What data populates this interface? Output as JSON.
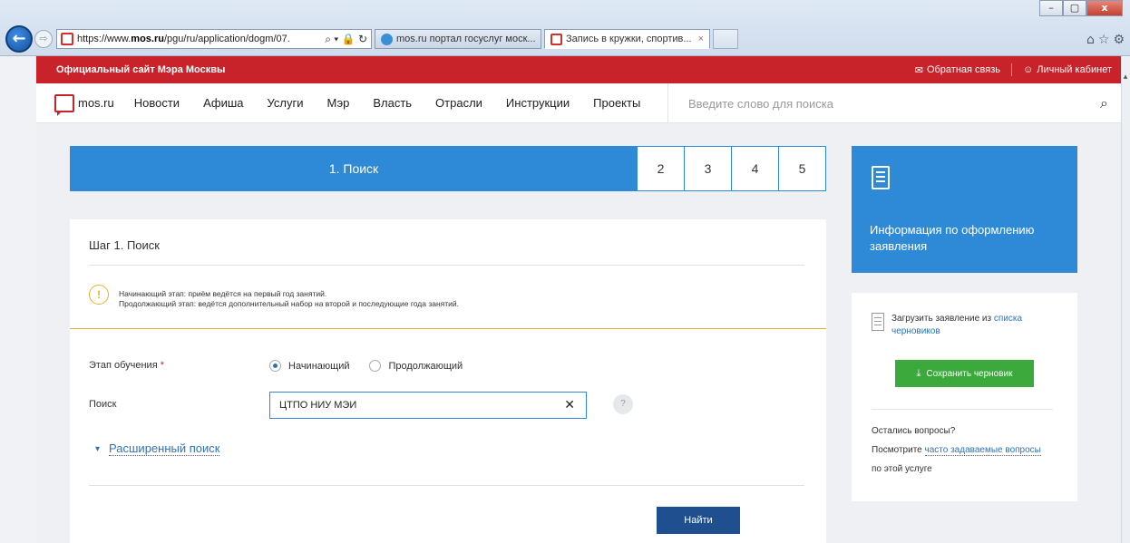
{
  "browser": {
    "url_prefix": "https://www.",
    "url_domain": "mos.ru",
    "url_rest": "/pgu/ru/application/dogm/07.",
    "address_tools": "⌕ ▾ 🔒 ↻",
    "tabs": [
      {
        "title": "mos.ru портал госуслуг моск..."
      },
      {
        "title": "Запись в кружки, спортив...",
        "close": "×"
      }
    ],
    "window_controls": [
      "–",
      "▢",
      "x"
    ],
    "toolbar_icons": "⌂☆⚙"
  },
  "site": {
    "official_label": "Официальный сайт Мэра Москвы",
    "feedback_label": "Обратная связь",
    "cabinet_label": "Личный кабинет",
    "logo_text": "mos.ru",
    "nav": [
      "Новости",
      "Афиша",
      "Услуги",
      "Мэр",
      "Власть",
      "Отрасли",
      "Инструкции",
      "Проекты"
    ],
    "search_placeholder": "Введите слово для поиска"
  },
  "steps": {
    "active_label": "1. Поиск",
    "others": [
      "2",
      "3",
      "4",
      "5"
    ]
  },
  "info_card": {
    "text": "Информация по оформлению заявления"
  },
  "side": {
    "draft_text": "Загрузить заявление из ",
    "draft_link": "списка черновиков",
    "save_label": "Сохранить черновик",
    "questions_line1": "Остались вопросы?",
    "questions_prefix": "Посмотрите ",
    "questions_link": "часто задаваемые вопросы",
    "questions_line3": "по этой услуге"
  },
  "form": {
    "title": "Шаг 1. Поиск",
    "notice_line1": "Начинающий этап: приём ведётся на первый год занятий.",
    "notice_line2": "Продолжающий этап: ведётся дополнительный набор на второй и последующие года занятий.",
    "stage_label": "Этап обучения",
    "required_mark": "*",
    "radio_options": [
      "Начинающий",
      "Продолжающий"
    ],
    "radio_selected": "Начинающий",
    "search_label": "Поиск",
    "search_value": "ЦТПО НИУ МЭИ",
    "advanced_label": "Расширенный поиск",
    "find_label": "Найти"
  },
  "colors": {
    "brand_red": "#c8232b",
    "step_blue": "#2e8ad6",
    "save_green": "#3ba93b",
    "find_navy": "#1f4f8f",
    "warning_yellow": "#e5b02b"
  }
}
